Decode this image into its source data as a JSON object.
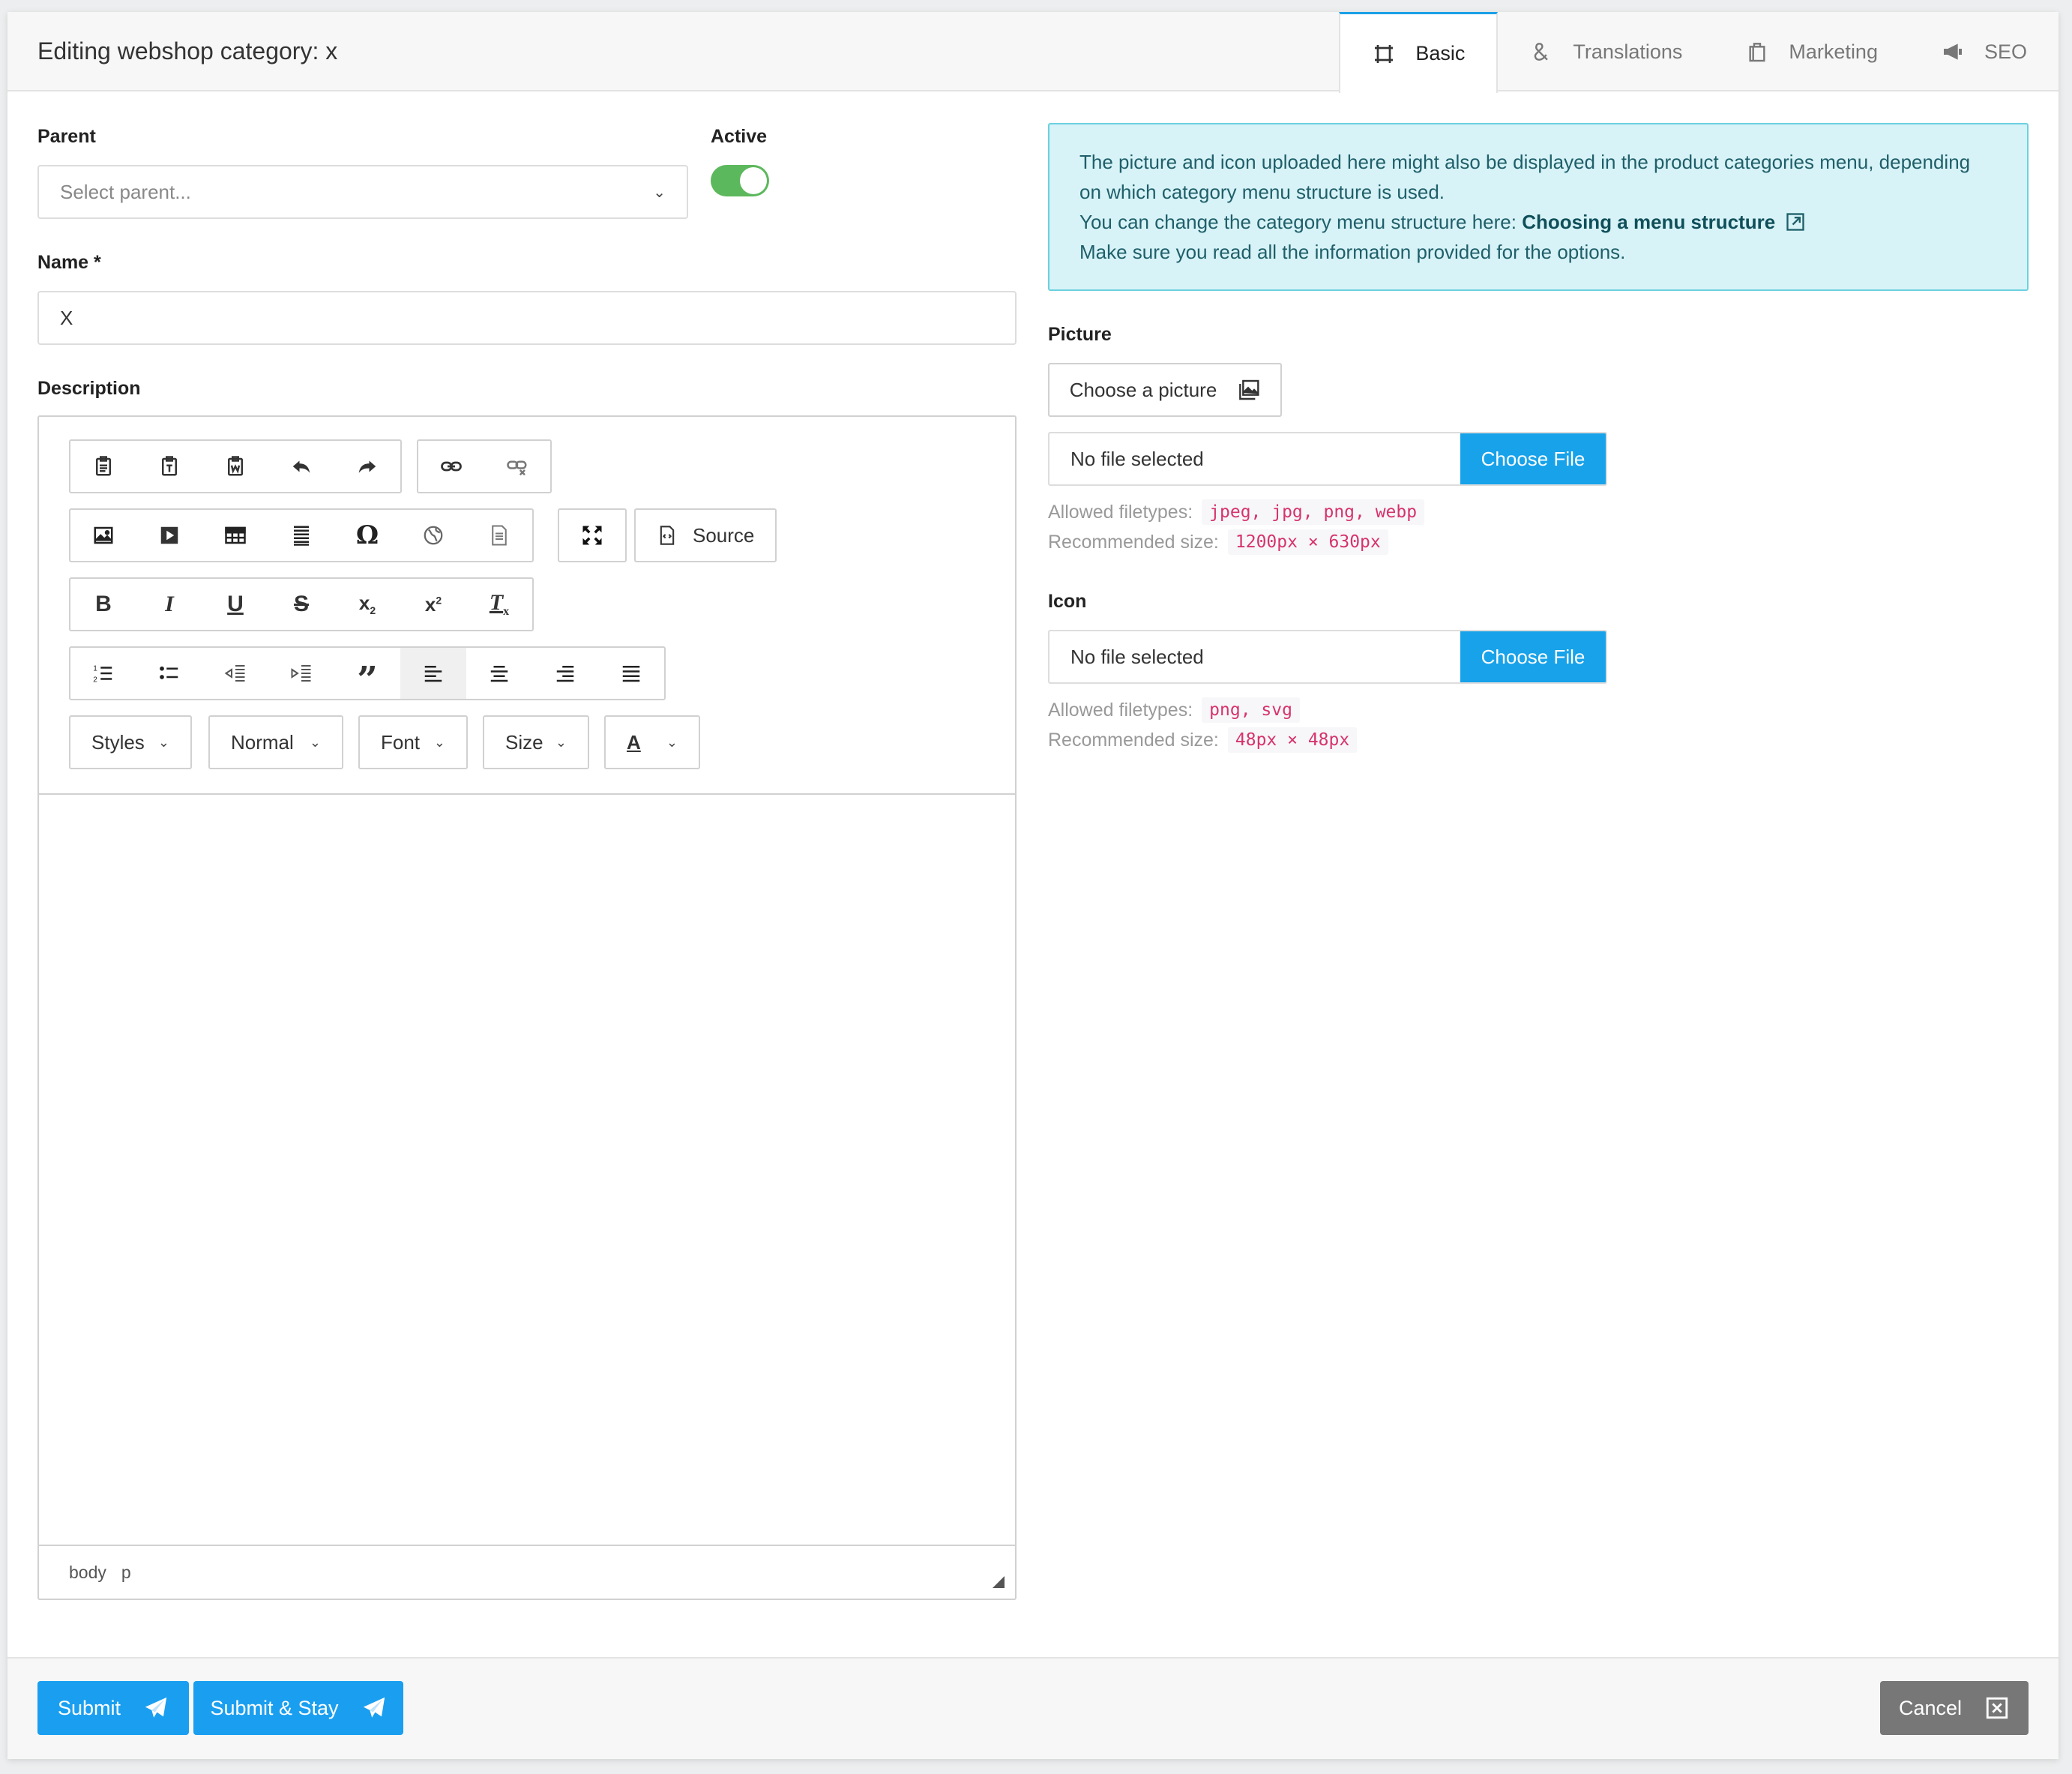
{
  "header": {
    "title": "Editing webshop category: x"
  },
  "tabs": [
    {
      "label": "Basic",
      "icon": "crop-frame-icon",
      "active": true
    },
    {
      "label": "Translations",
      "icon": "ampersand-icon"
    },
    {
      "label": "Marketing",
      "icon": "shopping-bag-icon"
    },
    {
      "label": "SEO",
      "icon": "megaphone-icon"
    }
  ],
  "form": {
    "parent_label": "Parent",
    "parent_placeholder": "Select parent...",
    "active_label": "Active",
    "active_on": true,
    "name_label": "Name *",
    "name_value": "X",
    "description_label": "Description"
  },
  "editor": {
    "combos": {
      "styles": "Styles",
      "format": "Normal",
      "font": "Font",
      "size": "Size"
    },
    "source_label": "Source",
    "status_path": [
      "body",
      "p"
    ]
  },
  "info": {
    "line1": "The picture and icon uploaded here might also be displayed in the product categories menu, depending on which category menu structure is used.",
    "line2_prefix": "You can change the category menu structure here: ",
    "line2_link": "Choosing a menu structure",
    "line3": "Make sure you read all the information provided for the options."
  },
  "picture": {
    "label": "Picture",
    "choose_button": "Choose a picture",
    "file_status": "No file selected",
    "file_button": "Choose File",
    "allowed_label": "Allowed filetypes:",
    "allowed_value": "jpeg, jpg, png, webp",
    "size_label": "Recommended size:",
    "size_value": "1200px × 630px"
  },
  "icon": {
    "label": "Icon",
    "file_status": "No file selected",
    "file_button": "Choose File",
    "allowed_label": "Allowed filetypes:",
    "allowed_value": "png, svg",
    "size_label": "Recommended size:",
    "size_value": "48px × 48px"
  },
  "footer": {
    "submit": "Submit",
    "submit_stay": "Submit & Stay",
    "cancel": "Cancel"
  },
  "colors": {
    "primary": "#1a9ff0",
    "toggle": "#5cb85c",
    "info_bg": "#d7f3f7",
    "cancel": "#777777",
    "code": "#d6336c"
  }
}
